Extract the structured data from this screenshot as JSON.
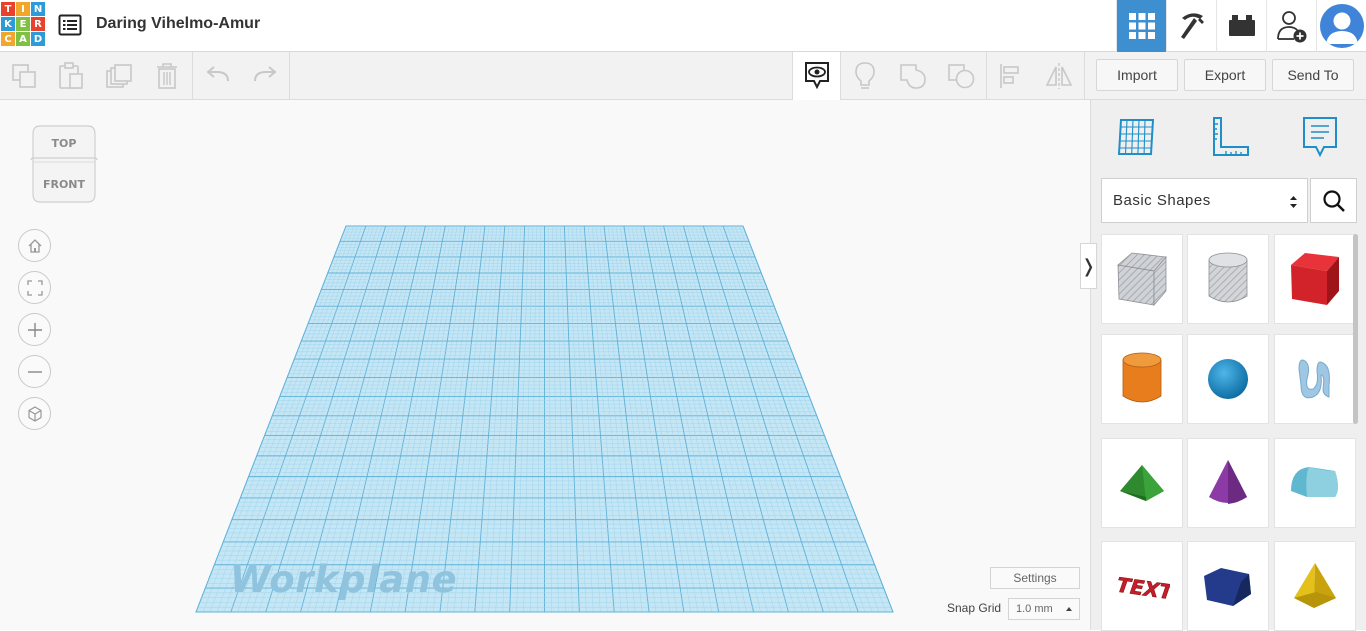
{
  "app": {
    "logo_letters": [
      "T",
      "I",
      "N",
      "K",
      "E",
      "R",
      "C",
      "A",
      "D"
    ],
    "logo_colors": [
      "#e8412c",
      "#f1a72c",
      "#2e9ad6",
      "#2e9ad6",
      "#80c044",
      "#e8412c",
      "#f1a72c",
      "#80c044",
      "#2e9ad6"
    ],
    "design_title": "Daring Vihelmo-Amur"
  },
  "top_nav": {
    "items": [
      {
        "name": "3d-design-view",
        "icon": "grid-icon",
        "active": true
      },
      {
        "name": "codeblocks",
        "icon": "pickaxe-icon",
        "active": false
      },
      {
        "name": "bricks",
        "icon": "brick-icon",
        "active": false
      },
      {
        "name": "invite",
        "icon": "add-user-icon",
        "active": false
      }
    ]
  },
  "toolbar": {
    "import_label": "Import",
    "export_label": "Export",
    "send_to_label": "Send To"
  },
  "viewcube": {
    "top_label": "TOP",
    "front_label": "FRONT"
  },
  "workspace": {
    "workplane_label": "Workplane",
    "settings_label": "Settings",
    "snap_grid_label": "Snap Grid",
    "snap_grid_value": "1.0 mm"
  },
  "panel": {
    "shape_category": "Basic Shapes",
    "shapes": [
      {
        "name": "Box Hole",
        "icon": "box-hole-icon"
      },
      {
        "name": "Cylinder Hole",
        "icon": "cylinder-hole-icon"
      },
      {
        "name": "Box",
        "icon": "box-icon",
        "color": "#d2232a"
      },
      {
        "name": "Cylinder",
        "icon": "cylinder-icon",
        "color": "#e87d1e"
      },
      {
        "name": "Sphere",
        "icon": "sphere-icon",
        "color": "#1a8fcf"
      },
      {
        "name": "Scribble",
        "icon": "scribble-icon",
        "color": "#9fc6e3"
      },
      {
        "name": "Roof",
        "icon": "roof-icon",
        "color": "#3aa33a"
      },
      {
        "name": "Cone",
        "icon": "cone-icon",
        "color": "#8c3ba6"
      },
      {
        "name": "Round Roof",
        "icon": "round-roof-icon",
        "color": "#5fb8cf"
      },
      {
        "name": "Text",
        "icon": "text-icon",
        "color": "#c41e2a"
      },
      {
        "name": "Polygon",
        "icon": "polygon-icon",
        "color": "#243b8c"
      },
      {
        "name": "Pyramid",
        "icon": "pyramid-icon",
        "color": "#e3c11a"
      }
    ]
  }
}
